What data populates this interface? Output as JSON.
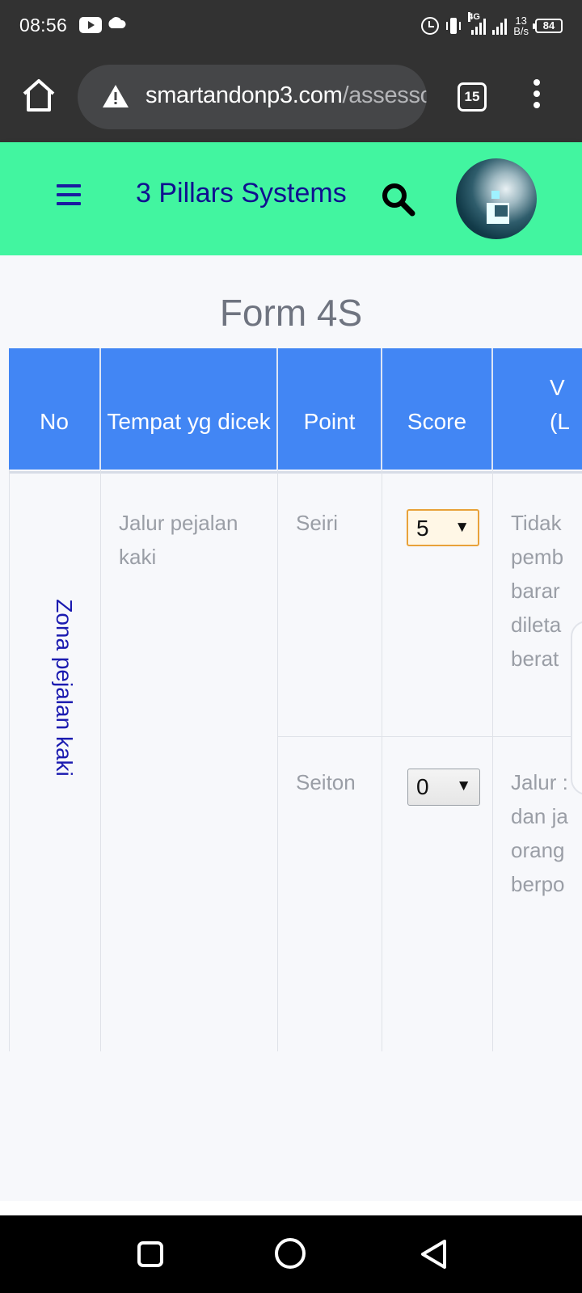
{
  "status_bar": {
    "time": "08:56",
    "network": "4G",
    "speed_value": "13",
    "speed_unit": "B/s",
    "battery": "84",
    "icons": [
      "youtube-icon",
      "cloud-icon",
      "alarm-icon",
      "vibrate-icon",
      "signal-icon",
      "battery-icon"
    ]
  },
  "browser": {
    "url_host": "smartandonp3.com",
    "url_path": "/assesso",
    "tab_count": "15",
    "icons": [
      "home-icon",
      "warning-icon",
      "more-vert-icon"
    ]
  },
  "app_header": {
    "title": "3 Pillars Systems",
    "background": "#42f5a0",
    "title_color": "#101090",
    "icons": [
      "menu-icon",
      "search-icon",
      "avatar"
    ]
  },
  "form": {
    "title": "Form 4S",
    "columns": [
      "No",
      "Tempat yg dicek",
      "Point",
      "Score",
      "V\n(L"
    ],
    "header_color": "#4286f4",
    "zone": "Zona pejalan kaki",
    "place": "Jalur pejalan kaki",
    "rows": [
      {
        "point": "Seiri",
        "score": "5",
        "description": "Tidak\npemb\nbarar\ndileta\nberat"
      },
      {
        "point": "Seiton",
        "score": "0",
        "description": "Jalur :\ndan ja\norang\nberpo"
      }
    ]
  },
  "nav_bar": {
    "icons": [
      "recent-apps-icon",
      "home-circle-icon",
      "back-icon"
    ]
  }
}
